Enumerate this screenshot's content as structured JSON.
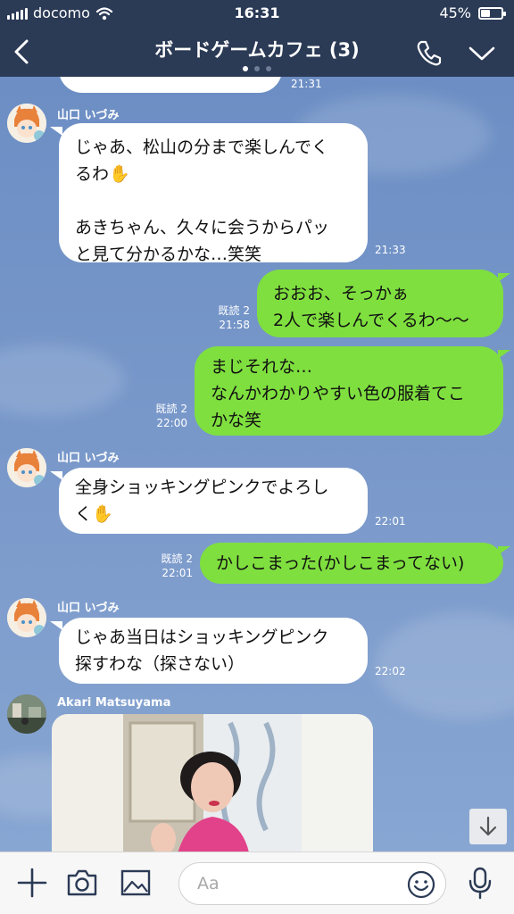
{
  "status": {
    "carrier": "docomo",
    "time": "16:31",
    "battery": "45%",
    "battery_level": 0.45
  },
  "header": {
    "title": "ボードゲームカフェ (3)",
    "page_indicator": {
      "count": 3,
      "active": 0
    }
  },
  "messages": [
    {
      "id": "m0",
      "side": "in",
      "time": "21:31"
    },
    {
      "id": "m1",
      "side": "in",
      "sender": "山口 いづみ",
      "text": "じゃあ、松山の分まで楽しんでく\nるわ✋\n\nあきちゃん、久々に会うからパッ\nと見て分かるかな…笑笑",
      "time": "21:33"
    },
    {
      "id": "m2",
      "side": "out",
      "read": "既読 2",
      "text": "おおお、そっかぁ\n2人で楽しんでくるわ〜〜",
      "time": "21:58"
    },
    {
      "id": "m3",
      "side": "out",
      "read": "既読 2",
      "text": "まじそれな…\nなんかわかりやすい色の服着てこ\nかな笑",
      "time": "22:00"
    },
    {
      "id": "m4",
      "side": "in",
      "sender": "山口 いづみ",
      "text": "全身ショッキングピンクでよろし\nく✋",
      "time": "22:01"
    },
    {
      "id": "m5",
      "side": "out",
      "read": "既読 2",
      "text": "かしこまった(かしこまってない)",
      "time": "22:01"
    },
    {
      "id": "m6",
      "side": "in",
      "sender": "山口 いづみ",
      "text": "じゃあ当日はショッキングピンク\n探すわな（探さない）",
      "time": "22:02"
    },
    {
      "id": "m7",
      "side": "in",
      "sender": "Akari Matsuyama",
      "kind": "photo"
    }
  ],
  "input": {
    "placeholder": "Aa"
  },
  "icons": {
    "back": "chevron-left-icon",
    "call": "phone-icon",
    "menu": "chevron-down-icon",
    "add": "plus-icon",
    "camera": "camera-icon",
    "image": "image-icon",
    "emoji": "smiley-icon",
    "mic": "microphone-icon",
    "scroll": "arrow-down-icon"
  },
  "colors": {
    "bar": "#2b3a55",
    "chat_bg": "#7392c4",
    "out_bubble": "#7fdf3f",
    "in_bubble": "#ffffff"
  }
}
